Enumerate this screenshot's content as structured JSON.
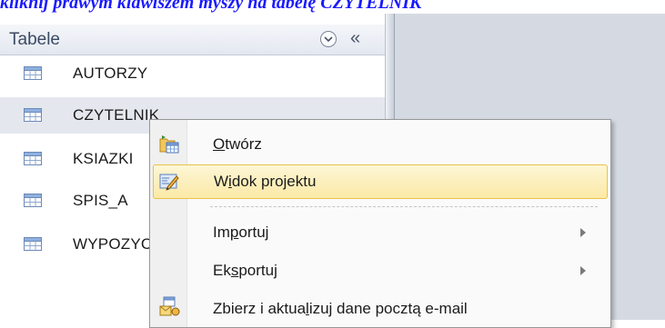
{
  "caption": "kliknij prawym klawiszem myszy na tabelę CZYTELNIK",
  "nav_pane": {
    "title": "Tabele",
    "dropdown_icon": "chevron-down-circle-icon",
    "collapse_glyph": "«",
    "items": [
      {
        "label": "AUTORZY",
        "icon": "table-icon"
      },
      {
        "label": "CZYTELNIK",
        "icon": "table-icon",
        "selected": true
      },
      {
        "label": "KSIAZKI",
        "icon": "table-icon"
      },
      {
        "label": "SPIS_A",
        "icon": "table-icon"
      },
      {
        "label": "WYPOZYCZENIA",
        "icon": "table-icon"
      }
    ]
  },
  "context_menu": {
    "open": {
      "pre": "",
      "u": "O",
      "post": "twórz",
      "icon": "open-table-icon"
    },
    "design_view": {
      "pre": "W",
      "u": "i",
      "post": "dok projektu",
      "icon": "design-view-icon",
      "highlighted": true
    },
    "import": {
      "pre": "Im",
      "u": "p",
      "post": "ortuj",
      "has_submenu": true
    },
    "export": {
      "pre": "Ek",
      "u": "s",
      "post": "portuj",
      "has_submenu": true
    },
    "collect_data": {
      "pre": "Zbierz i aktua",
      "u": "l",
      "post": "izuj dane pocztą e-mail",
      "icon": "collect-email-data-icon"
    }
  },
  "colors": {
    "caption": "#1a1aff",
    "highlight_border": "#e7c24d",
    "workspace": "#d5dae2"
  }
}
